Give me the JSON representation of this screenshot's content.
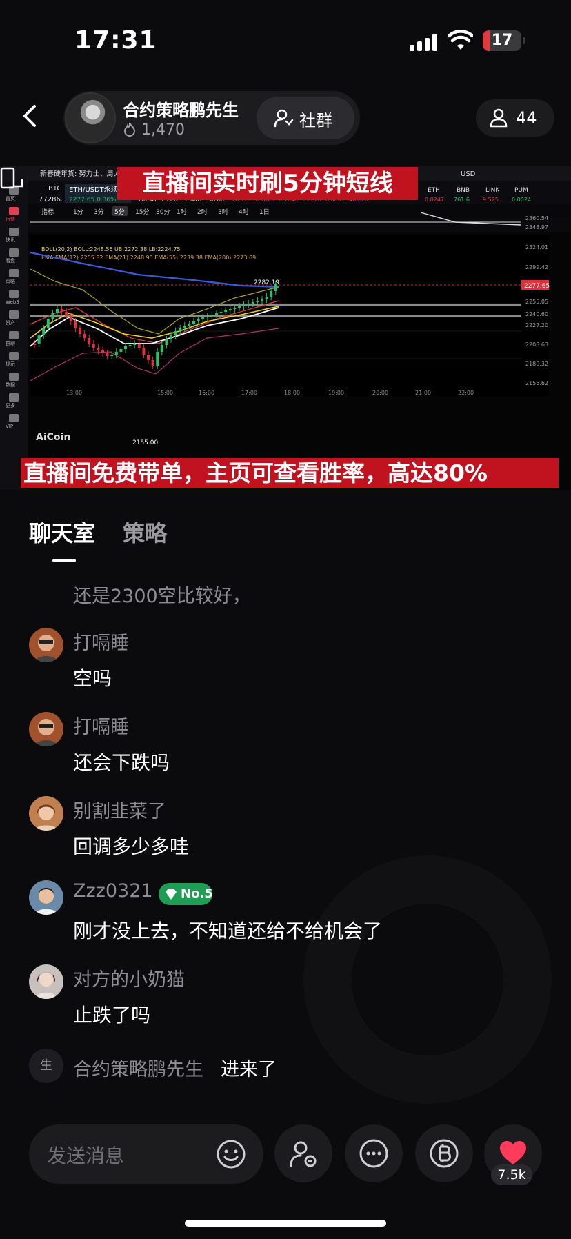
{
  "status_bar": {
    "time": "17:31",
    "battery": "17",
    "battery_level": 0.17
  },
  "header": {
    "host_name": "合约策略鹏先生",
    "likes": "1,470",
    "community_label": "社群",
    "viewers": "44"
  },
  "stream": {
    "banner_top": "直播间实时刷5分钟短线",
    "banner_bottom": "直播间免费带单，主页可查看胜率，高达80%",
    "logo": "AiCoin",
    "pair": "ETH/USDT永续",
    "ticker": "BTC",
    "price": "77286.",
    "sub_price": "2277.65 0.36%",
    "stats": [
      "102.47",
      "25552.",
      "23461.",
      "58.80",
      "16.776",
      "0.1822",
      "0.1040",
      "296.28",
      "0.0051",
      "4699.0"
    ],
    "right_tickers": [
      "ETH",
      "BNB",
      "LINK",
      "PUM"
    ],
    "right_values": [
      "0.0247",
      "761.6",
      "9.525",
      "0.0024"
    ],
    "timeframes": [
      "指标",
      "1分",
      "3分",
      "5分",
      "15分",
      "30分",
      "1时",
      "2时",
      "3时",
      "4时",
      "1日"
    ],
    "active_timeframe": "5分",
    "indicator_boll": "BOLL(20,2) BOLL:2248.56 UB:2272.38 LB:2224.75",
    "indicator_ema": "EMA EMA(12):2255.82 EMA(21):2248.95 EMA(55):2239.38 EMA(200):2273.69",
    "high_label": "2282.19",
    "low_label": "2155.00",
    "x_ticks": [
      "13:00",
      "15:00",
      "16:00",
      "17:00",
      "18:00",
      "19:00",
      "20:00",
      "21:00",
      "22:00"
    ],
    "y_ticks": [
      "2360.54",
      "2348.97",
      "2324.01",
      "2299.42",
      "2277.65",
      "2255.05",
      "2240.60",
      "2227.20",
      "2203.63",
      "2180.32",
      "2155.62"
    ],
    "current_price": "2277.65",
    "top_bar_text": "新春硬年货: 努力士、周大生",
    "currency": "USD",
    "sidebar_labels": [
      "首页",
      "行情",
      "快讯",
      "看盘",
      "策略",
      "Web3",
      "资产",
      "群聊",
      "提示",
      "数据",
      "更多",
      "VIP"
    ]
  },
  "tabs": {
    "chat": "聊天室",
    "strategy": "策略"
  },
  "chat": {
    "faded_message": "还是2300空比较好，",
    "messages": [
      {
        "user": "打嗝睡",
        "text": "空吗"
      },
      {
        "user": "打嗝睡",
        "text": "还会下跌吗"
      },
      {
        "user": "别割韭菜了",
        "text": "回调多少多哇"
      },
      {
        "user": "Zzz0321",
        "text": "刚才没上去，不知道还给不给机会了",
        "badge": "No.5"
      },
      {
        "user": "对方的小奶猫",
        "text": "止跌了吗"
      }
    ],
    "join": {
      "avatar_char": "生",
      "user": "合约策略鹏先生",
      "action": "进来了"
    }
  },
  "bottom_bar": {
    "input_placeholder": "发送消息",
    "like_count": "7.5k"
  },
  "colors": {
    "accent_red": "#c1121f",
    "badge_green": "#1f9d55",
    "like_red": "#ff3b5c",
    "background": "#0b0b0d"
  }
}
